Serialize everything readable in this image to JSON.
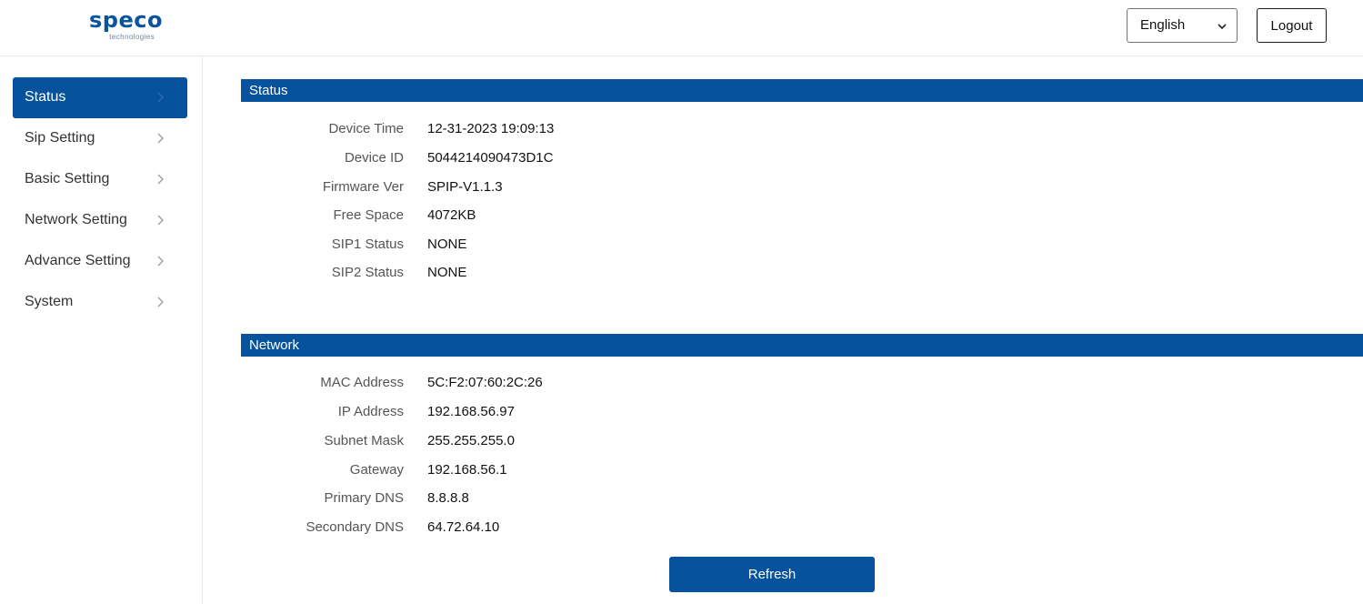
{
  "header": {
    "logo_text": "speco",
    "logo_subtext": "technologies",
    "language": {
      "selected": "English"
    },
    "logout_label": "Logout"
  },
  "sidebar": {
    "items": [
      {
        "label": "Status",
        "active": true
      },
      {
        "label": "Sip Setting",
        "active": false
      },
      {
        "label": "Basic Setting",
        "active": false
      },
      {
        "label": "Network Setting",
        "active": false
      },
      {
        "label": "Advance Setting",
        "active": false
      },
      {
        "label": "System",
        "active": false
      }
    ]
  },
  "status": {
    "title": "Status",
    "rows": [
      {
        "label": "Device Time",
        "value": "12-31-2023 19:09:13"
      },
      {
        "label": "Device ID",
        "value": "5044214090473D1C"
      },
      {
        "label": "Firmware Ver",
        "value": "SPIP-V1.1.3"
      },
      {
        "label": "Free Space",
        "value": "4072KB"
      },
      {
        "label": "SIP1 Status",
        "value": "NONE"
      },
      {
        "label": "SIP2 Status",
        "value": "NONE"
      }
    ]
  },
  "network": {
    "title": "Network",
    "rows": [
      {
        "label": "MAC Address",
        "value": "5C:F2:07:60:2C:26"
      },
      {
        "label": "IP Address",
        "value": "192.168.56.97"
      },
      {
        "label": "Subnet Mask",
        "value": "255.255.255.0"
      },
      {
        "label": "Gateway",
        "value": "192.168.56.1"
      },
      {
        "label": "Primary DNS",
        "value": "8.8.8.8"
      },
      {
        "label": "Secondary DNS",
        "value": "64.72.64.10"
      }
    ]
  },
  "refresh_label": "Refresh",
  "colors": {
    "accent": "#06529d",
    "logo": "#0a53a0"
  }
}
